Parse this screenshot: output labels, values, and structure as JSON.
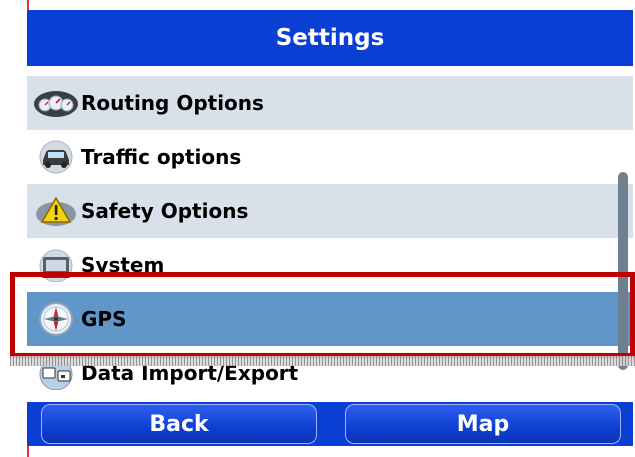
{
  "header": {
    "title": "Settings"
  },
  "menu": {
    "items": [
      {
        "label": "Routing Options",
        "icon": "speedometer-icon"
      },
      {
        "label": "Traffic options",
        "icon": "car-icon"
      },
      {
        "label": "Safety Options",
        "icon": "warning-icon"
      },
      {
        "label": "System",
        "icon": "computer-icon"
      },
      {
        "label": "GPS",
        "icon": "compass-icon"
      },
      {
        "label": "Data Import/Export",
        "icon": "data-transfer-icon"
      }
    ],
    "selected_index": 4
  },
  "footer": {
    "back_label": "Back",
    "map_label": "Map"
  },
  "colors": {
    "header_bg": "#0a3fd4",
    "row_alt_bg": "#d8e0ea",
    "row_bg": "#ffffff",
    "selected_bg": "#6096c8",
    "highlight_border": "#bf0000"
  }
}
